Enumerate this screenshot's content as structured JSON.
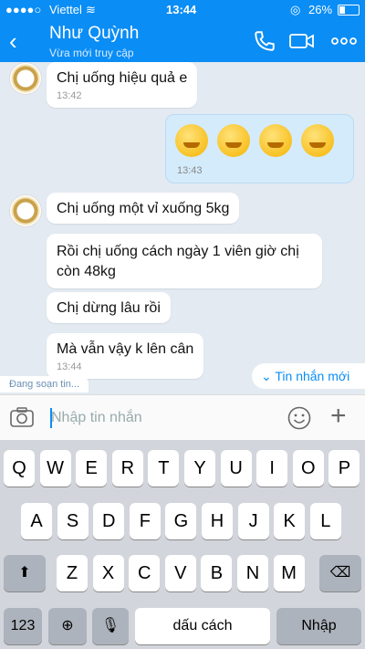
{
  "status": {
    "carrier": "Viettel",
    "time": "13:44",
    "battery": "26%"
  },
  "header": {
    "name": "Như Quỳnh",
    "subtitle": "Vừa mới truy cập"
  },
  "messages": [
    {
      "text": "Chị uống hiệu quả e",
      "time": "13:42"
    },
    {
      "time": "13:43"
    },
    {
      "text": "Chị uống một vỉ xuống 5kg"
    },
    {
      "text": "Rồi chị uống cách ngày 1 viên giờ chị còn 48kg"
    },
    {
      "text": "Chị dừng lâu rồi"
    },
    {
      "text": "Mà vẫn vậy k lên cân",
      "time": "13:44"
    }
  ],
  "typing": "Đang soạn tin...",
  "new_messages": "Tin nhắn mới",
  "input": {
    "placeholder": "Nhập tin nhắn"
  },
  "keyboard": {
    "row1": [
      "Q",
      "W",
      "E",
      "R",
      "T",
      "Y",
      "U",
      "I",
      "O",
      "P"
    ],
    "row2": [
      "A",
      "S",
      "D",
      "F",
      "G",
      "H",
      "J",
      "K",
      "L"
    ],
    "row3": [
      "Z",
      "X",
      "C",
      "V",
      "B",
      "N",
      "M"
    ],
    "num": "123",
    "space": "dấu cách",
    "enter": "Nhập"
  }
}
